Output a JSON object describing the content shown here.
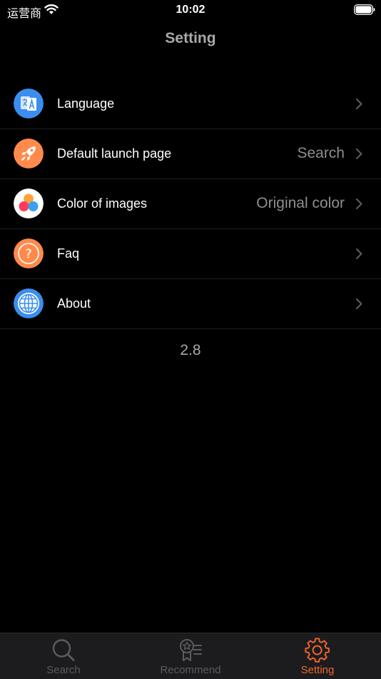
{
  "status_bar": {
    "carrier": "运营商",
    "time": "10:02"
  },
  "header": {
    "title": "Setting"
  },
  "settings": {
    "items": [
      {
        "label": "Language",
        "value": "",
        "icon": "translate-icon",
        "icon_color": "#3b8ef0"
      },
      {
        "label": "Default launch page",
        "value": "Search",
        "icon": "rocket-icon",
        "icon_color": "#ff8a4c"
      },
      {
        "label": "Color of images",
        "value": "Original color",
        "icon": "color-circles-icon",
        "icon_color": "#ffffff"
      },
      {
        "label": "Faq",
        "value": "",
        "icon": "question-icon",
        "icon_color": "#ff8a4c"
      },
      {
        "label": "About",
        "value": "",
        "icon": "globe-icon",
        "icon_color": "#3b8ef0"
      }
    ],
    "version": "2.8"
  },
  "tab_bar": {
    "tabs": [
      {
        "label": "Search",
        "icon": "search-icon",
        "active": false
      },
      {
        "label": "Recommend",
        "icon": "award-list-icon",
        "active": false
      },
      {
        "label": "Setting",
        "icon": "gear-icon",
        "active": true
      }
    ],
    "active_color": "#f0642b",
    "inactive_color": "#5b5b5f"
  }
}
